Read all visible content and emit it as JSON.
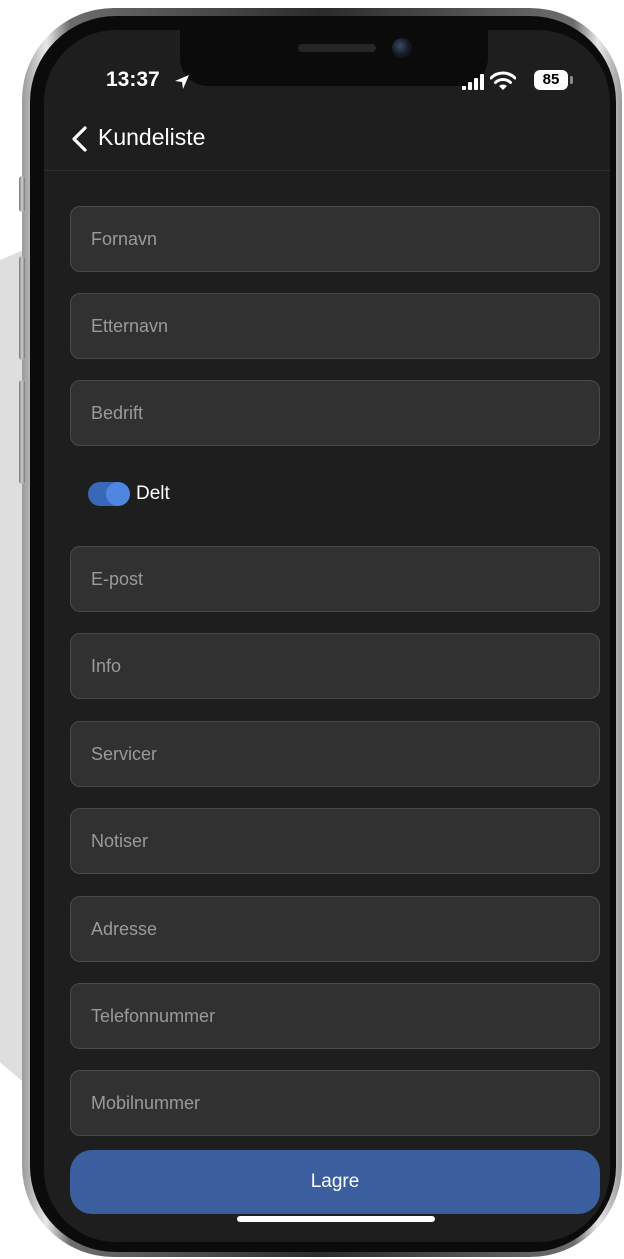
{
  "status_bar": {
    "time": "13:37",
    "battery_level": "85",
    "icons": [
      "location-arrow-icon",
      "signal-icon",
      "wifi-icon",
      "battery-icon"
    ]
  },
  "navbar": {
    "back_icon": "chevron-left-icon",
    "back_label": "Kundeliste"
  },
  "form": {
    "fields": [
      {
        "placeholder": "Fornavn",
        "value": ""
      },
      {
        "placeholder": "Etternavn",
        "value": ""
      },
      {
        "placeholder": "Bedrift",
        "value": ""
      },
      {
        "placeholder": "E-post",
        "value": ""
      },
      {
        "placeholder": "Info",
        "value": ""
      },
      {
        "placeholder": "Servicer",
        "value": ""
      },
      {
        "placeholder": "Notiser",
        "value": ""
      },
      {
        "placeholder": "Adresse",
        "value": ""
      },
      {
        "placeholder": "Telefonnummer",
        "value": ""
      },
      {
        "placeholder": "Mobilnummer",
        "value": ""
      }
    ],
    "shared_toggle": {
      "label": "Delt",
      "checked": true
    },
    "save_label": "Lagre"
  },
  "colors": {
    "background": "#1e1e1e",
    "field_background": "#313131",
    "field_border": "#4a4a4a",
    "placeholder_text": "#9a9a9a",
    "accent": "#3a5e9e",
    "toggle_on": "#4f86e2"
  }
}
